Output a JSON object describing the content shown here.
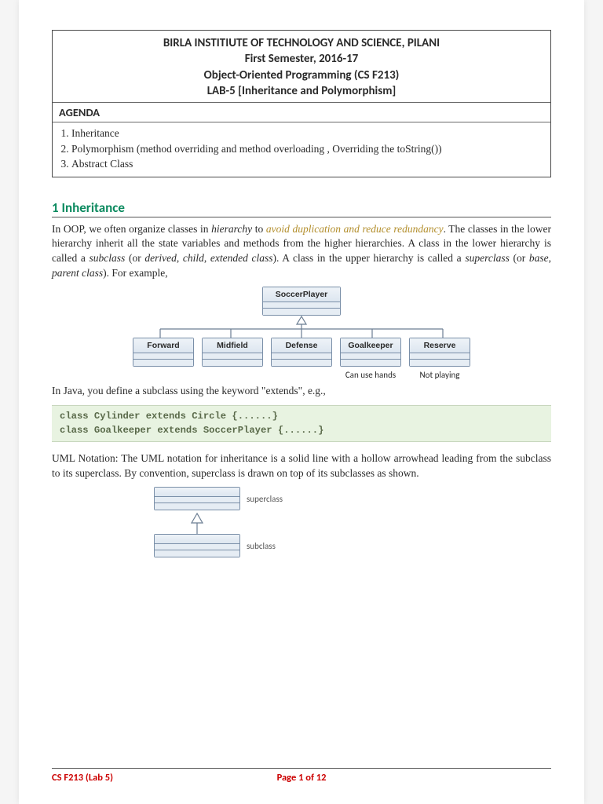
{
  "header": {
    "line1": "BIRLA INSTITIUTE OF TECHNOLOGY AND SCIENCE, PILANI",
    "line2": "First Semester, 2016-17",
    "line3": "Object-Oriented Programming (CS F213)",
    "line4": "LAB-5 [Inheritance and Polymorphism]",
    "agenda_title": "AGENDA",
    "agenda_items": [
      "Inheritance",
      "Polymorphism (method overriding and method overloading , Overriding the toString())",
      "Abstract Class"
    ]
  },
  "section1": {
    "heading": "1 Inheritance",
    "para1_a": "In OOP, we often organize classes in ",
    "para1_hierarchy": "hierarchy",
    "para1_b": " to ",
    "para1_emph": "avoid duplication and reduce redundancy",
    "para1_c": ". The classes in the lower hierarchy inherit all the state variables and methods from the higher hierarchies. A class in the lower hierarchy is called a ",
    "para1_subclass": "subclass",
    "para1_d": " (or ",
    "para1_derived": "derived",
    "para1_e": ", ",
    "para1_child": "child",
    "para1_f": ", ",
    "para1_extended": "extended class",
    "para1_g": "). A class in the upper hierarchy is called a ",
    "para1_superclass": "superclass",
    "para1_h": " (or ",
    "para1_base": "base",
    "para1_i": ", ",
    "para1_parent": "parent class",
    "para1_j": "). For example,"
  },
  "uml1": {
    "superclass": "SoccerPlayer",
    "subclasses": [
      "Forward",
      "Midfield",
      "Defense",
      "Goalkeeper",
      "Reserve"
    ],
    "caption_goalkeeper": "Can use hands",
    "caption_reserve": "Not playing"
  },
  "para2": "In Java, you define a subclass using the keyword \"extends\", e.g.,",
  "code": {
    "line1": "class Cylinder extends Circle {......}",
    "line2": "class Goalkeeper extends SoccerPlayer {......}"
  },
  "para3": "UML Notation: The UML notation for inheritance is a solid line with a hollow arrowhead leading from the subclass to its superclass. By convention, superclass is drawn on top of its subclasses as shown.",
  "uml2": {
    "super_label": "superclass",
    "sub_label": "subclass"
  },
  "footer": {
    "left": "CS F213 (Lab 5)",
    "page": "Page 1 of 12"
  }
}
